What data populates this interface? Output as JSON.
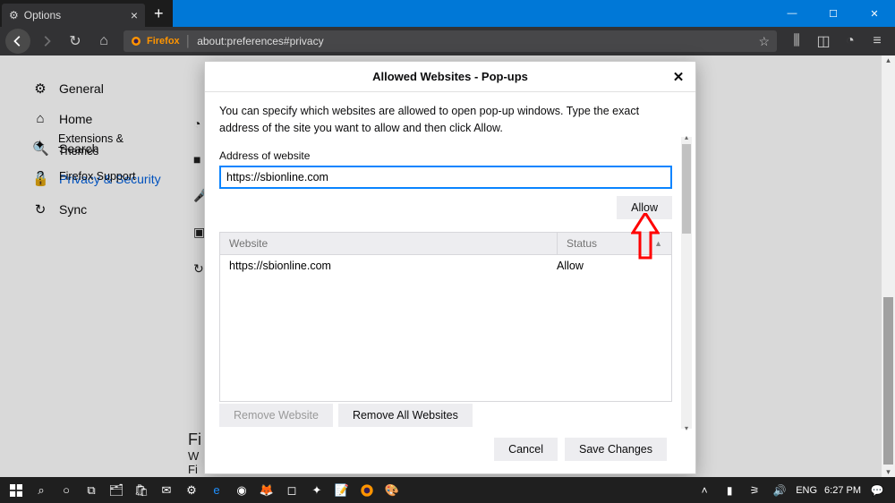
{
  "window": {
    "tab_title": "Options",
    "url_prefix": "Firefox",
    "url": "about:preferences#privacy"
  },
  "sidebar": {
    "items": [
      {
        "icon": "⚙",
        "label": "General"
      },
      {
        "icon": "⌂",
        "label": "Home"
      },
      {
        "icon": "🔍",
        "label": "Search"
      },
      {
        "icon": "🔒",
        "label": "Privacy & Security"
      },
      {
        "icon": "↻",
        "label": "Sync"
      }
    ],
    "bottom": [
      {
        "icon": "✦",
        "label": "Extensions & Themes"
      },
      {
        "icon": "?",
        "label": "Firefox Support"
      }
    ]
  },
  "background_section": {
    "heading_fragment1": "Fi",
    "heading_fragment2": "W",
    "heading_fragment3": "Fi"
  },
  "dialog": {
    "title": "Allowed Websites - Pop-ups",
    "description": "You can specify which websites are allowed to open pop-up windows. Type the exact address of the site you want to allow and then click Allow.",
    "address_label": "Address of website",
    "address_value": "https://sbionline.com",
    "allow_button": "Allow",
    "columns": {
      "website": "Website",
      "status": "Status"
    },
    "rows": [
      {
        "website": "https://sbionline.com",
        "status": "Allow"
      }
    ],
    "remove_website": "Remove Website",
    "remove_all": "Remove All Websites",
    "cancel": "Cancel",
    "save": "Save Changes"
  },
  "taskbar": {
    "lang": "ENG",
    "time": "6:27 PM"
  }
}
